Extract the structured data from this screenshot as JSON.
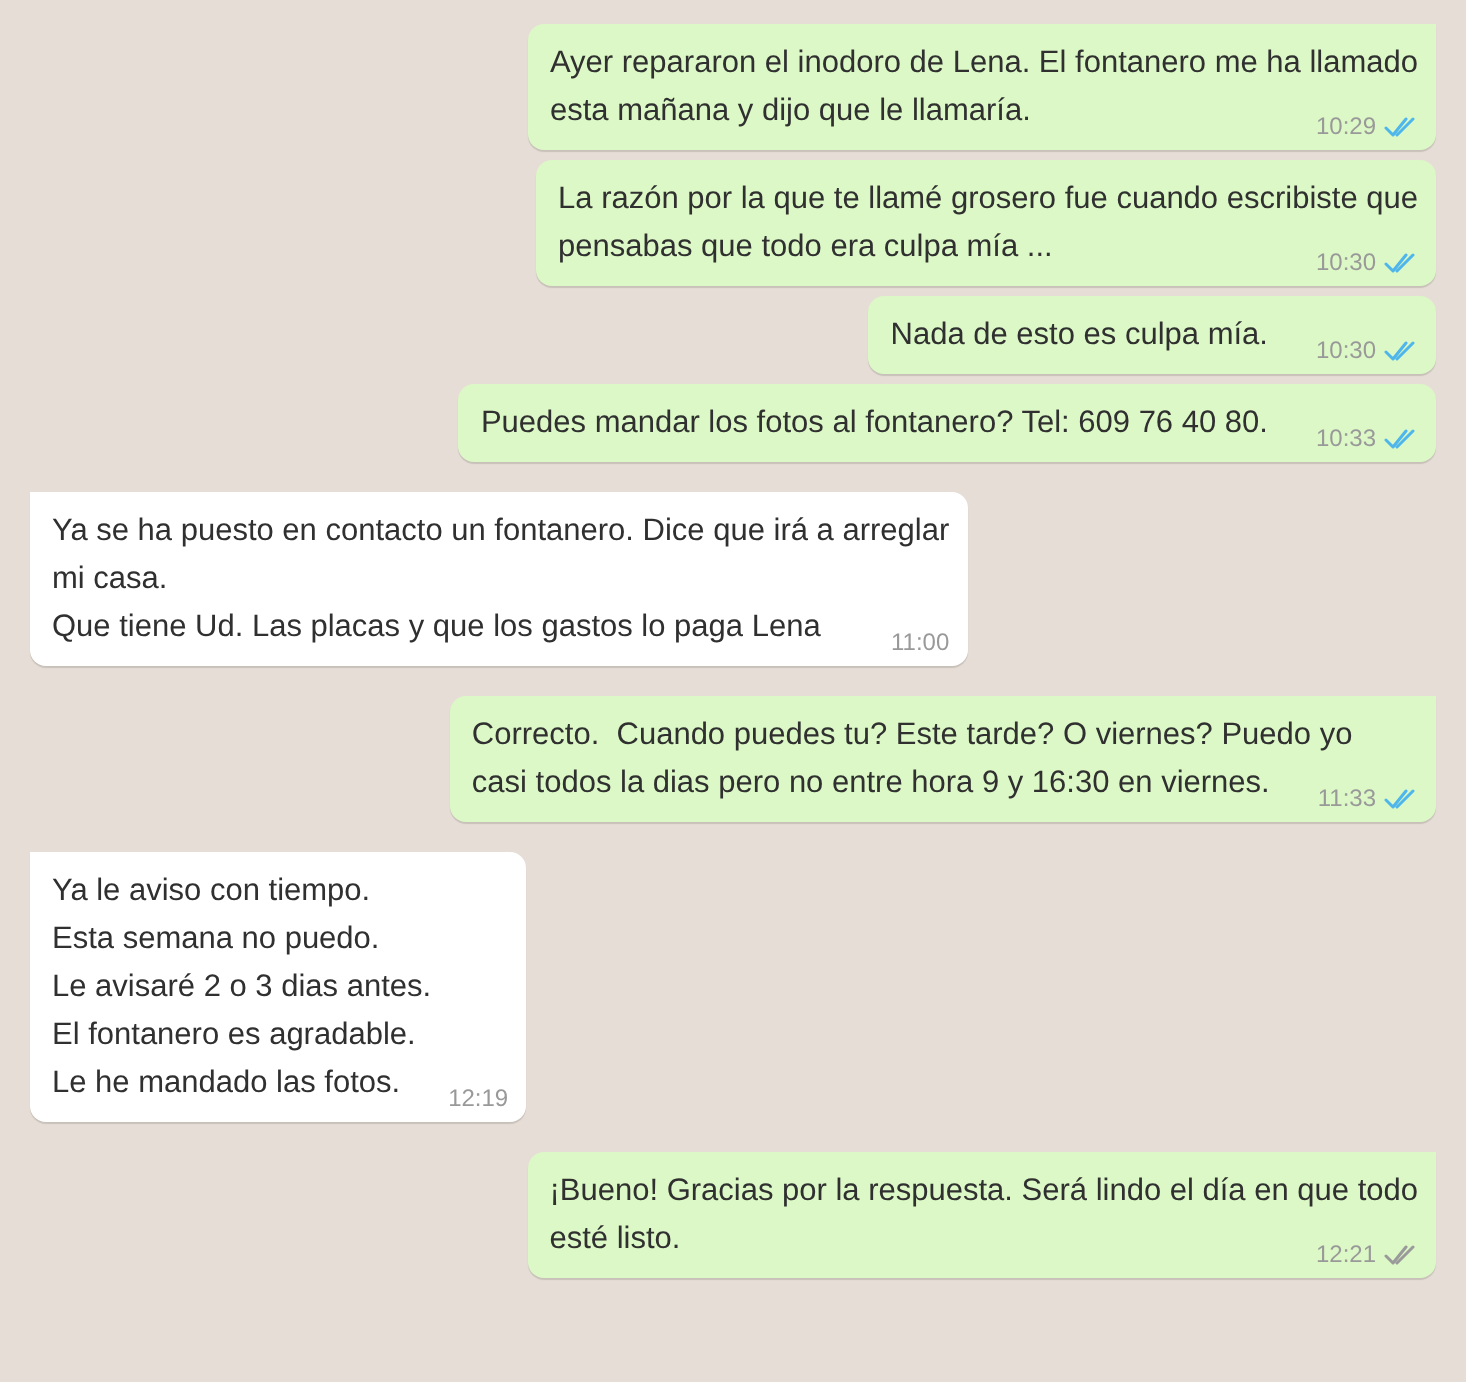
{
  "messages": [
    {
      "kind": "outgoing",
      "tail": true,
      "lines": [
        "Ayer repararon el inodoro de Lena. El fontanero me ha llamado",
        "esta mañana y dijo que le llamaría."
      ],
      "time": "10:29",
      "read": true
    },
    {
      "kind": "outgoing",
      "tail": false,
      "lines": [
        "La razón por la que te llamé grosero fue cuando escribiste que",
        "pensabas que todo era culpa mía ..."
      ],
      "time": "10:30",
      "read": true
    },
    {
      "kind": "outgoing",
      "tail": false,
      "lines": [
        "Nada de esto es culpa mía."
      ],
      "time": "10:30",
      "read": true
    },
    {
      "kind": "outgoing",
      "tail": false,
      "lines": [
        "Puedes mandar los fotos al fontanero? Tel: 609 76 40 80."
      ],
      "time": "10:33",
      "read": true
    },
    {
      "kind": "incoming",
      "tail": true,
      "lines": [
        "Ya se ha puesto en contacto un fontanero. Dice que irá a arreglar",
        "mi casa.",
        "Que tiene Ud. Las placas y que los gastos lo paga Lena"
      ],
      "time": "11:00"
    },
    {
      "kind": "outgoing",
      "tail": true,
      "lines": [
        "Correcto.  Cuando puedes tu? Este tarde? O viernes? Puedo yo",
        "casi todos la dias pero no entre hora 9 y 16:30 en viernes."
      ],
      "time": "11:33",
      "read": true
    },
    {
      "kind": "incoming",
      "tail": true,
      "lines": [
        "Ya le aviso con tiempo.",
        "Esta semana no puedo.",
        "Le avisaré 2 o 3 dias antes.",
        "El fontanero es agradable.",
        "Le he mandado las fotos."
      ],
      "time": "12:19"
    },
    {
      "kind": "outgoing",
      "tail": true,
      "lines": [
        "¡Bueno! Gracias por la respuesta. Será lindo el día en que todo",
        "esté listo."
      ],
      "time": "12:21",
      "read": false
    }
  ]
}
